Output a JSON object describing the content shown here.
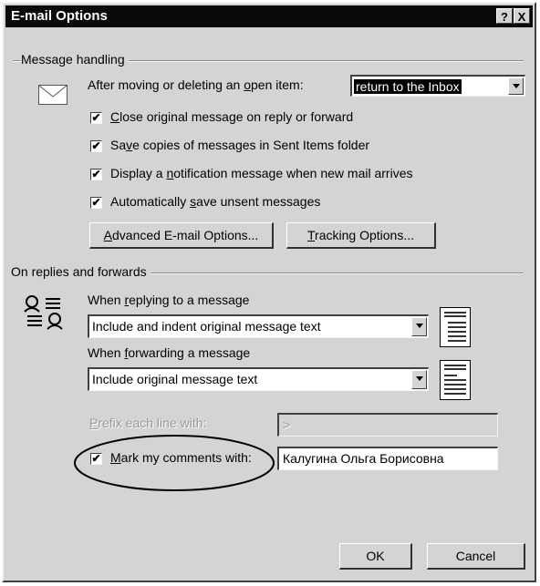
{
  "window": {
    "title": "E-mail Options",
    "help_btn": "?",
    "close_btn": "X"
  },
  "message_handling": {
    "group_label": "Message handling",
    "after_moving_pre": "After moving or deleting an ",
    "after_moving_u": "o",
    "after_moving_post": "pen item:",
    "after_moving_value": "return to the Inbox",
    "checks": [
      {
        "pre": "",
        "u": "C",
        "post": "lose original message on reply or forward",
        "checked": true
      },
      {
        "pre": "Sa",
        "u": "v",
        "post": "e copies of messages in Sent Items folder",
        "checked": true
      },
      {
        "pre": "Display a ",
        "u": "n",
        "post": "otification message when new mail arrives",
        "checked": true
      },
      {
        "pre": "Automatically ",
        "u": "s",
        "post": "ave unsent messages",
        "checked": true
      }
    ],
    "advanced_btn_u": "A",
    "advanced_btn_post": "dvanced E-mail Options...",
    "tracking_btn_u": "T",
    "tracking_btn_post": "racking Options..."
  },
  "replies": {
    "group_label": "On replies and forwards",
    "reply_pre": "When ",
    "reply_u": "r",
    "reply_post": "eplying to a message",
    "reply_value": "Include and indent original message text",
    "forward_pre": "When ",
    "forward_u": "f",
    "forward_post": "orwarding a message",
    "forward_value": "Include original message text",
    "prefix_u": "P",
    "prefix_post": "refix each line with:",
    "prefix_value": ">",
    "mark_u": "M",
    "mark_post": "ark my comments with:",
    "mark_checked": true,
    "mark_value": "Калугина Ольга Борисовна"
  },
  "footer": {
    "ok": "OK",
    "cancel": "Cancel"
  },
  "icons": {
    "envelope": "envelope-icon",
    "reply": "reply-people-icon",
    "check": "✔"
  }
}
